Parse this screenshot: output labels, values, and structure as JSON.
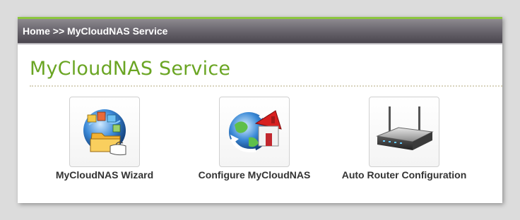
{
  "breadcrumb": "Home >> MyCloudNAS Service",
  "page_title": "MyCloudNAS Service",
  "items": [
    {
      "label": "MyCloudNAS Wizard",
      "icon": "wizard-globe-folder-icon"
    },
    {
      "label": "Configure MyCloudNAS",
      "icon": "globe-house-icon"
    },
    {
      "label": "Auto Router Configuration",
      "icon": "router-icon"
    }
  ],
  "colors": {
    "accent_green": "#6aa523",
    "titlebar_top": "#8d8a8f",
    "titlebar_bottom": "#4a464e",
    "top_border": "#8cc63f"
  }
}
